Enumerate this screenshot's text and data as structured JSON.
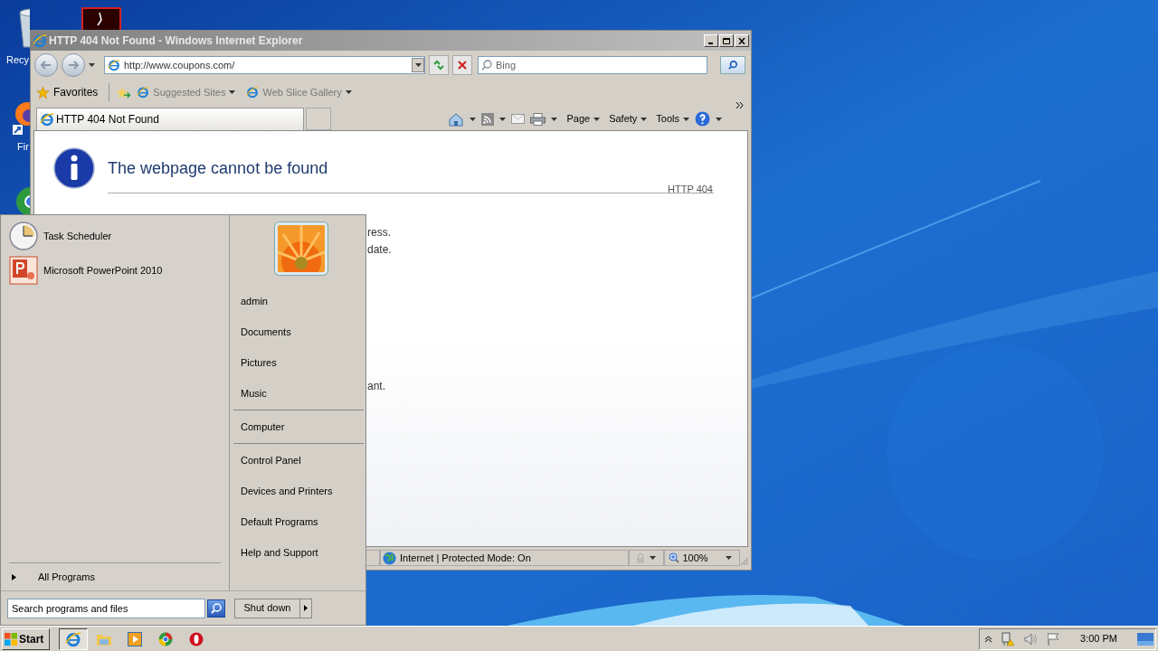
{
  "desktop": {
    "icons": [
      {
        "kind": "recycle",
        "label": "Recy"
      },
      {
        "kind": "pdf"
      },
      {
        "kind": "firefox",
        "label": "Fir"
      },
      {
        "kind": "chrome"
      }
    ]
  },
  "browser": {
    "title": "HTTP 404 Not Found - Windows Internet Explorer",
    "address": "http://www.coupons.com/",
    "search_placeholder": "Bing",
    "favorites": "Favorites",
    "links": [
      "Suggested Sites",
      "Web Slice Gallery"
    ],
    "tabs": [
      {
        "label": "HTTP 404 Not Found",
        "selected": true
      }
    ],
    "commands": [
      "Page",
      "Safety",
      "Tools"
    ],
    "page": {
      "heading": "The webpage cannot be found",
      "code": "HTTP 404",
      "fragments": [
        "ress.",
        "date.",
        "ant."
      ]
    },
    "status": {
      "zone": "Internet | Protected Mode: On",
      "zoom": "100%"
    }
  },
  "start_menu": {
    "pinned": [
      {
        "kind": "clock",
        "label": "Task Scheduler"
      },
      {
        "kind": "powerpoint",
        "label": "Microsoft PowerPoint 2010"
      }
    ],
    "all_programs": "All Programs",
    "search_placeholder": "Search programs and files",
    "user": "admin",
    "groups": [
      {
        "items": [
          "Documents",
          "Pictures",
          "Music"
        ]
      },
      {
        "items": [
          "Computer"
        ]
      },
      {
        "items": [
          "Control Panel",
          "Devices and Printers",
          "Default Programs",
          "Help and Support"
        ]
      }
    ],
    "shutdown": "Shut down"
  },
  "taskbar": {
    "start": "Start",
    "apps": [
      {
        "kind": "ie",
        "selected": true
      },
      {
        "kind": "folder",
        "selected": false
      },
      {
        "kind": "media",
        "selected": false
      },
      {
        "kind": "chrome",
        "selected": false
      },
      {
        "kind": "opera",
        "selected": false
      }
    ],
    "clock": "3:00 PM"
  }
}
